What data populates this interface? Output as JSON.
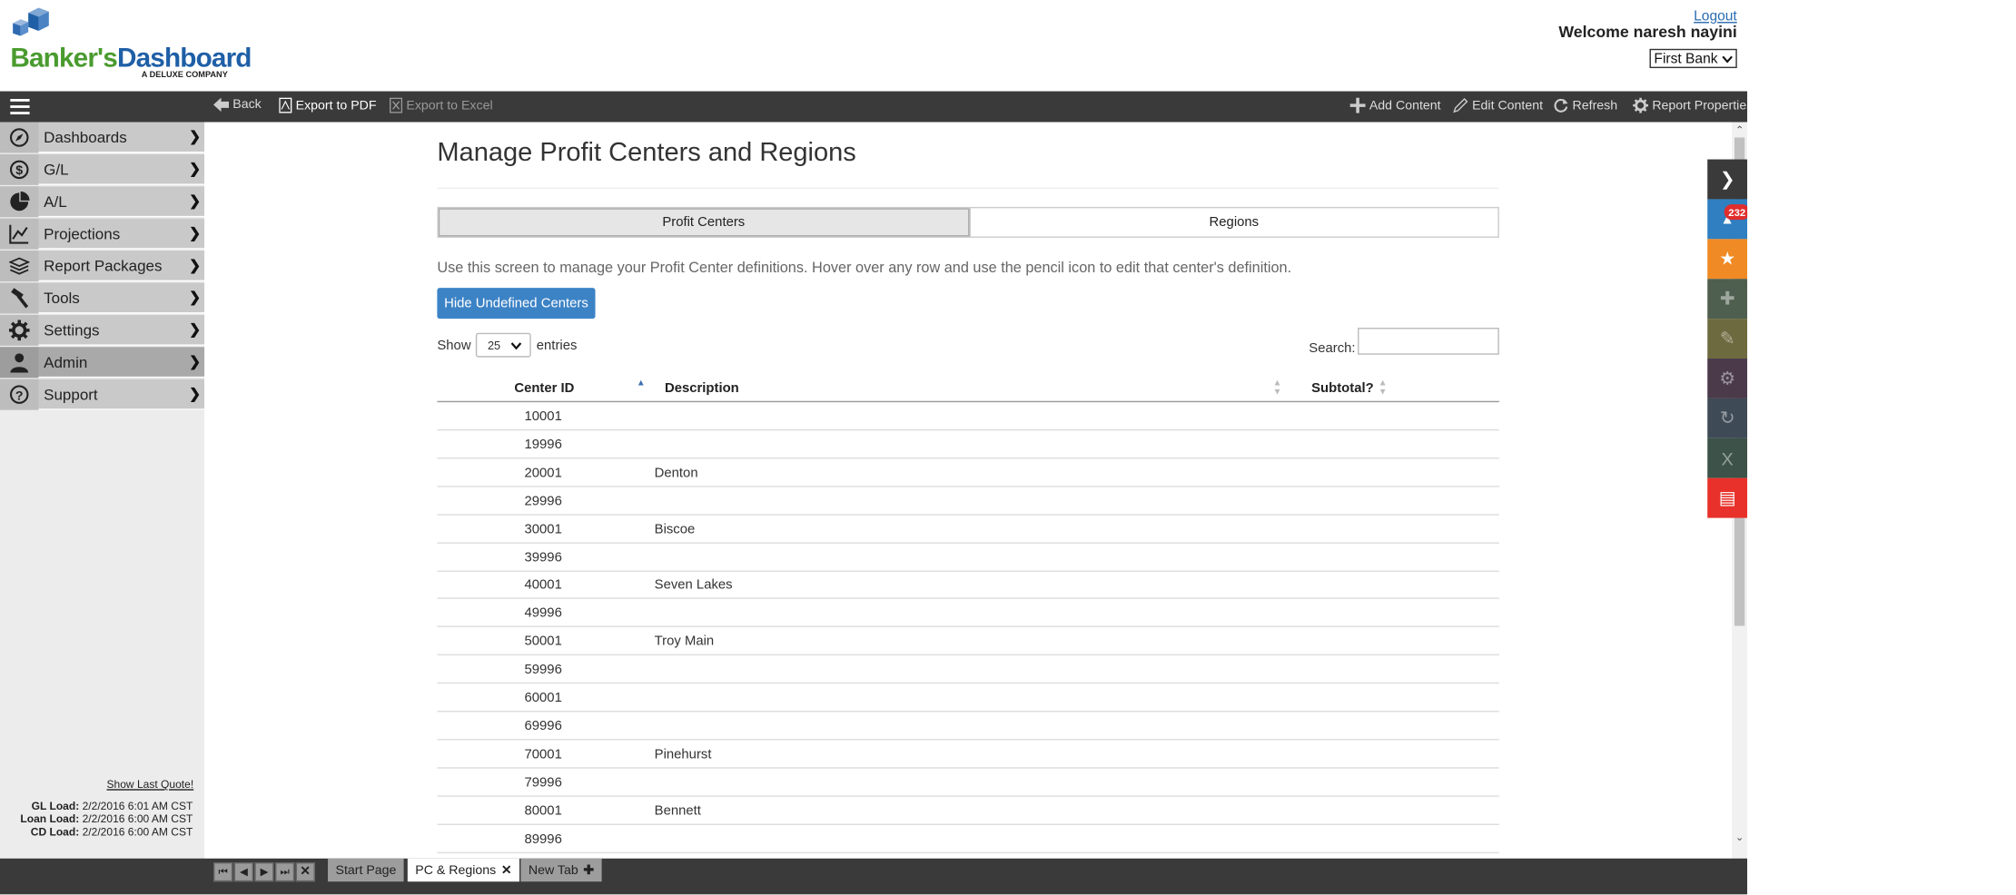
{
  "header": {
    "logo": {
      "part1": "Banker's",
      "part2": "Dashboard",
      "sub": "A DELUXE COMPANY"
    },
    "logout": "Logout",
    "welcome": "Welcome  naresh nayini",
    "bank": "First Bank"
  },
  "toolbar": {
    "back": "Back",
    "export_pdf": "Export to PDF",
    "export_excel": "Export to Excel",
    "add_content": "Add Content",
    "edit_content": "Edit Content",
    "refresh": "Refresh",
    "report_properties": "Report Properties"
  },
  "sidebar": {
    "items": [
      {
        "label": "Dashboards",
        "icon": "compass-icon"
      },
      {
        "label": "G/L",
        "icon": "dollar-icon"
      },
      {
        "label": "A/L",
        "icon": "pie-icon"
      },
      {
        "label": "Projections",
        "icon": "line-chart-icon"
      },
      {
        "label": "Report Packages",
        "icon": "layers-icon"
      },
      {
        "label": "Tools",
        "icon": "hammer-icon"
      },
      {
        "label": "Settings",
        "icon": "gear-icon"
      },
      {
        "label": "Admin",
        "icon": "user-icon"
      },
      {
        "label": "Support",
        "icon": "question-icon"
      }
    ],
    "show_last_quote": "Show Last Quote!",
    "loads": [
      {
        "label": "GL Load:",
        "value": "2/2/2016 6:01 AM CST"
      },
      {
        "label": "Loan Load:",
        "value": "2/2/2016 6:00 AM CST"
      },
      {
        "label": "CD Load:",
        "value": "2/2/2016 6:00 AM CST"
      }
    ]
  },
  "main": {
    "title": "Manage Profit Centers and Regions",
    "tabs": [
      "Profit Centers",
      "Regions"
    ],
    "help": "Use this screen to manage your Profit Center definitions. Hover over any row and use the pencil icon to edit that center's definition.",
    "hide_button": "Hide Undefined Centers",
    "show_label": "Show",
    "page_size": "25",
    "entries_label": "entries",
    "search_label": "Search:",
    "columns": [
      "Center ID",
      "Description",
      "Subtotal?"
    ],
    "rows": [
      {
        "id": "10001",
        "desc": ""
      },
      {
        "id": "19996",
        "desc": ""
      },
      {
        "id": "20001",
        "desc": "Denton"
      },
      {
        "id": "29996",
        "desc": ""
      },
      {
        "id": "30001",
        "desc": "Biscoe"
      },
      {
        "id": "39996",
        "desc": ""
      },
      {
        "id": "40001",
        "desc": "Seven Lakes"
      },
      {
        "id": "49996",
        "desc": ""
      },
      {
        "id": "50001",
        "desc": "Troy Main"
      },
      {
        "id": "59996",
        "desc": ""
      },
      {
        "id": "60001",
        "desc": ""
      },
      {
        "id": "69996",
        "desc": ""
      },
      {
        "id": "70001",
        "desc": "Pinehurst"
      },
      {
        "id": "79996",
        "desc": ""
      },
      {
        "id": "80001",
        "desc": "Bennett"
      },
      {
        "id": "89996",
        "desc": ""
      }
    ]
  },
  "rail": {
    "notification_count": "232",
    "colors": [
      "#3a3a3a",
      "#2f7fc1",
      "#f08a24",
      "#4f5f4f",
      "#6e6a40",
      "#4a3a4a",
      "#3e4a55",
      "#3d5248",
      "#e8312a"
    ]
  },
  "bottom_tabs": [
    {
      "label": "Start Page"
    },
    {
      "label": "PC & Regions"
    },
    {
      "label": "New Tab"
    }
  ]
}
